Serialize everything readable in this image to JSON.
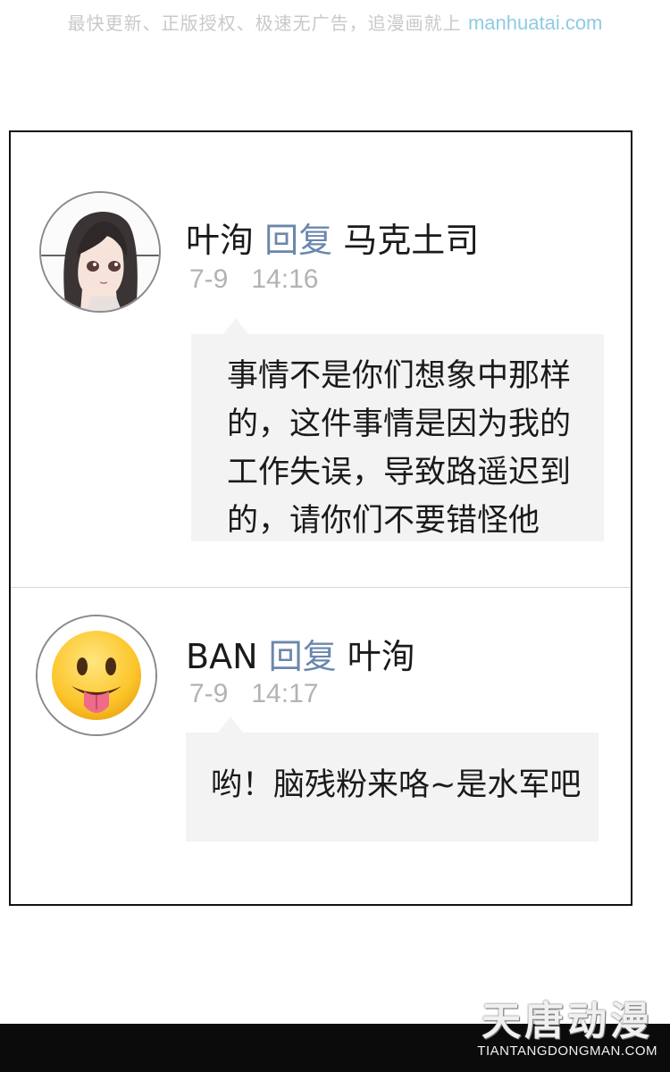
{
  "banner": {
    "text": "最快更新、正版授权、极速无广告，追漫画就上 ",
    "site": "manhuatai.com"
  },
  "comments": [
    {
      "avatar_icon": "girl-portrait-avatar",
      "author": "叶洵",
      "reply_word": "回复",
      "target": "马克土司",
      "date": "7-9",
      "time": "14:16",
      "text": "事情不是你们想象中那样\n的，这件事情是因为我的\n工作失误，导致路遥迟到\n的，请你们不要错怪他"
    },
    {
      "avatar_icon": "tongue-out-emoji-avatar",
      "author": "BAN",
      "reply_word": "回复",
      "target": "叶洵",
      "date": "7-9",
      "time": "14:17",
      "text": "哟！脑残粉来咯~是水军吧"
    }
  ],
  "watermark": {
    "title": "天唐动漫",
    "url": "TIANTANGDONGMAN.COM"
  },
  "colors": {
    "reply": "#6b87ad",
    "timestamp": "#b3b3b3",
    "bubble": "#f3f3f3",
    "banner_site": "#8fcbe3"
  }
}
